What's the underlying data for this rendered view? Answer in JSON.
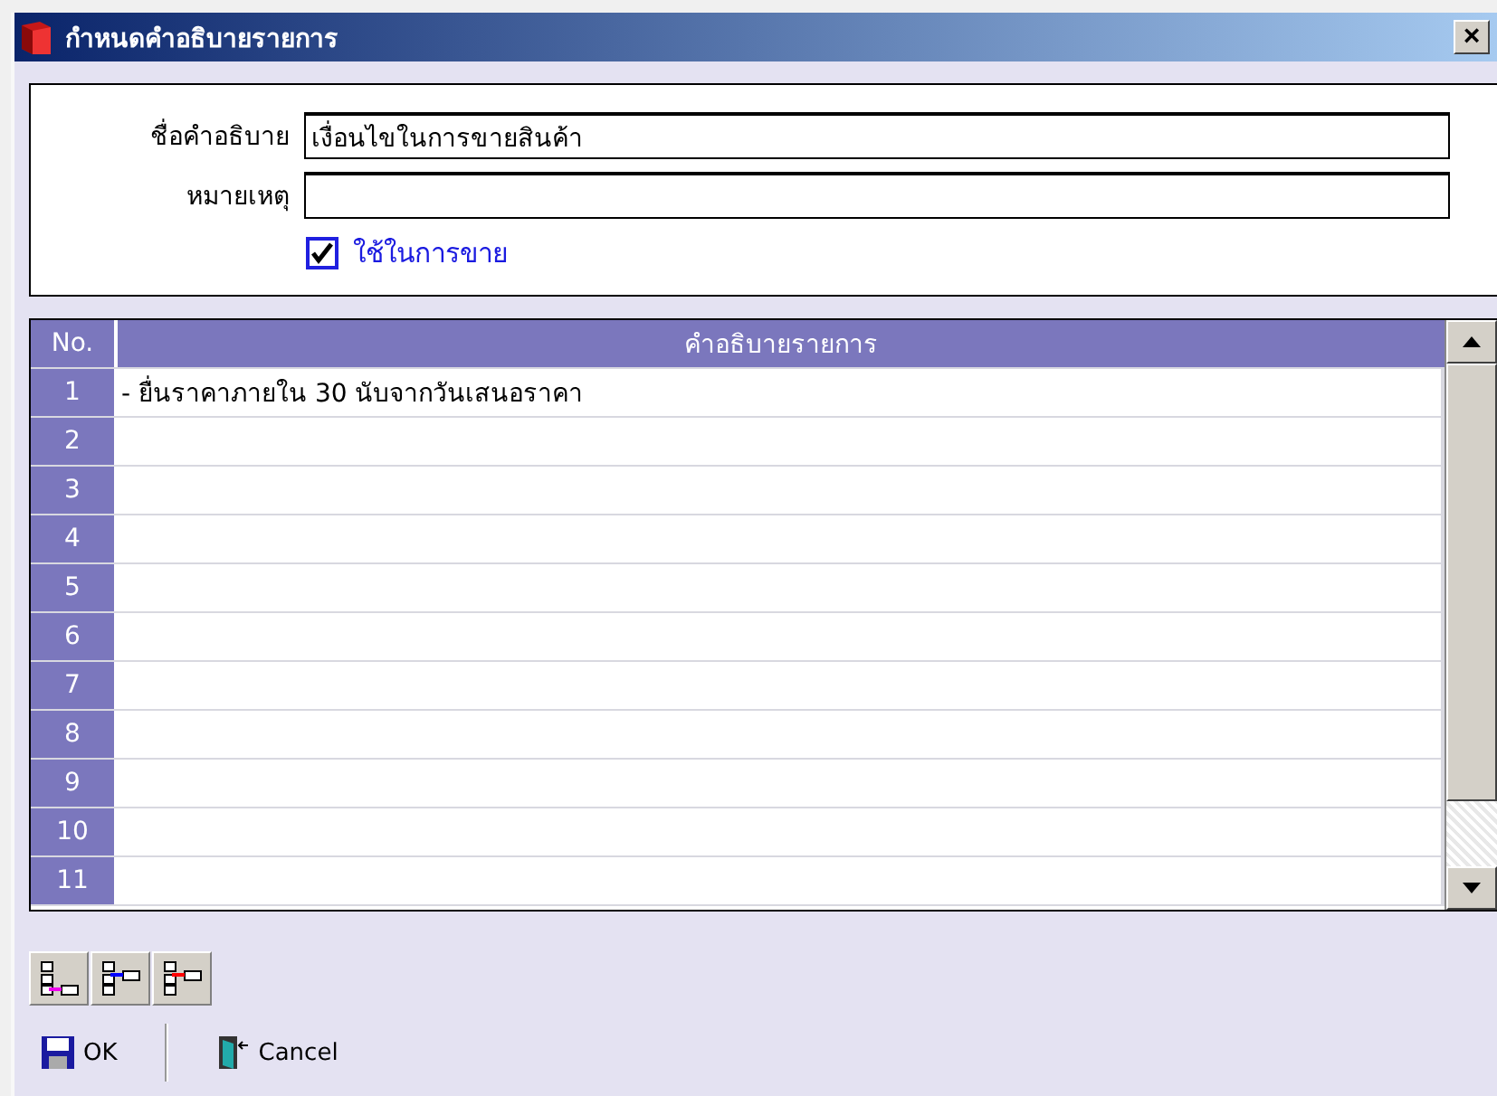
{
  "window": {
    "title": "กำหนดคำอธิบายรายการ",
    "close": "×"
  },
  "form": {
    "name_label": "ชื่อคำอธิบาย",
    "name_value": "เงื่อนไขในการขายสินค้า",
    "note_label": "หมายเหตุ",
    "use_for_sale": {
      "label": "ใช้ในการขาย",
      "checked": true
    }
  },
  "table": {
    "columns": [
      "No.",
      "คำอธิบายรายการ"
    ],
    "rows": [
      {
        "no": "1",
        "description": "- ยื่นราคาภายใน 30 นับจากวันเสนอราคา"
      },
      {
        "no": "2"
      },
      {
        "no": "3"
      },
      {
        "no": "4"
      },
      {
        "no": "5"
      },
      {
        "no": "6"
      },
      {
        "no": "7"
      },
      {
        "no": "8"
      },
      {
        "no": "9"
      },
      {
        "no": "10"
      },
      {
        "no": "11"
      }
    ]
  },
  "buttons": [
    {
      "kind": "ok",
      "label": "OK"
    },
    {
      "kind": "cancel",
      "label": "Cancel"
    }
  ]
}
